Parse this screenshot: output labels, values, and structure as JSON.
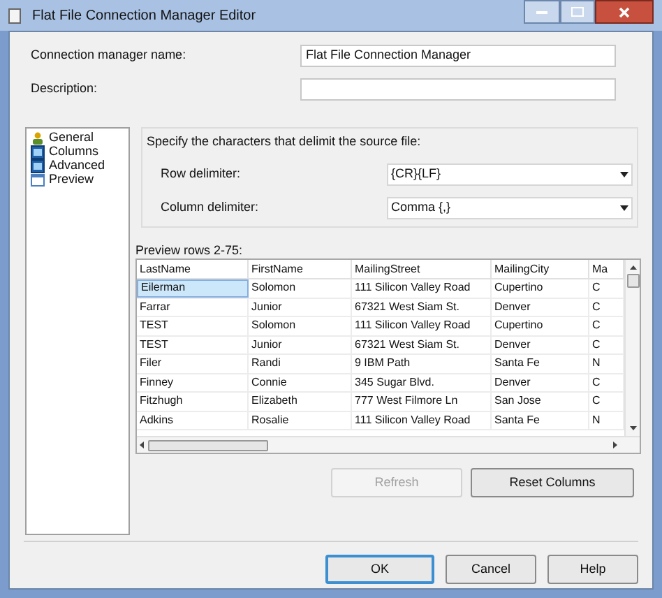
{
  "window": {
    "title": "Flat File Connection Manager Editor"
  },
  "name_field": {
    "label": "Connection manager name:",
    "value": "Flat File Connection Manager"
  },
  "description_field": {
    "label": "Description:"
  },
  "nav": [
    {
      "label": "General",
      "kind": "general",
      "selected": false
    },
    {
      "label": "Columns",
      "kind": "grid",
      "selected": false
    },
    {
      "label": "Advanced",
      "kind": "grid",
      "selected": false
    },
    {
      "label": "Preview",
      "kind": "window",
      "selected": false
    }
  ],
  "delimiters": {
    "prompt": "Specify the characters that delimit the source file:",
    "fields": [
      {
        "label": "Row delimiter:",
        "value": "{CR}{LF}"
      },
      {
        "label": "Column delimiter:",
        "value": "Comma {,}"
      }
    ]
  },
  "preview": {
    "label": "Preview rows 2-75:",
    "columns": [
      "LastName",
      "FirstName",
      "MailingStreet",
      "MailingCity",
      "Ma"
    ],
    "rows": [
      {
        "cells": [
          "Eilerman",
          "Solomon",
          "111 Silicon Valley Road",
          "Cupertino",
          "C"
        ],
        "selected": true
      },
      {
        "cells": [
          "Farrar",
          "Junior",
          "67321 West Siam St.",
          "Denver",
          "C"
        ],
        "selected": false
      },
      {
        "cells": [
          "TEST",
          "Solomon",
          "111 Silicon Valley Road",
          "Cupertino",
          "C"
        ],
        "selected": false
      },
      {
        "cells": [
          "TEST",
          "Junior",
          "67321 West Siam St.",
          "Denver",
          "C"
        ],
        "selected": false
      },
      {
        "cells": [
          "Filer",
          "Randi",
          "9 IBM Path",
          "Santa Fe",
          "N"
        ],
        "selected": false
      },
      {
        "cells": [
          "Finney",
          "Connie",
          "345 Sugar Blvd.",
          "Denver",
          "C"
        ],
        "selected": false
      },
      {
        "cells": [
          "Fitzhugh",
          "Elizabeth",
          "777 West Filmore Ln",
          "San Jose",
          "C"
        ],
        "selected": false
      },
      {
        "cells": [
          "Adkins",
          "Rosalie",
          "111 Silicon Valley Road",
          "Santa Fe",
          "N"
        ],
        "selected": false
      }
    ]
  },
  "actions": [
    {
      "label": "Refresh",
      "disabled": true
    },
    {
      "label": "Reset Columns",
      "disabled": false
    }
  ],
  "footer": [
    {
      "label": "OK",
      "default": true
    },
    {
      "label": "Cancel",
      "default": false
    },
    {
      "label": "Help",
      "default": false
    }
  ]
}
